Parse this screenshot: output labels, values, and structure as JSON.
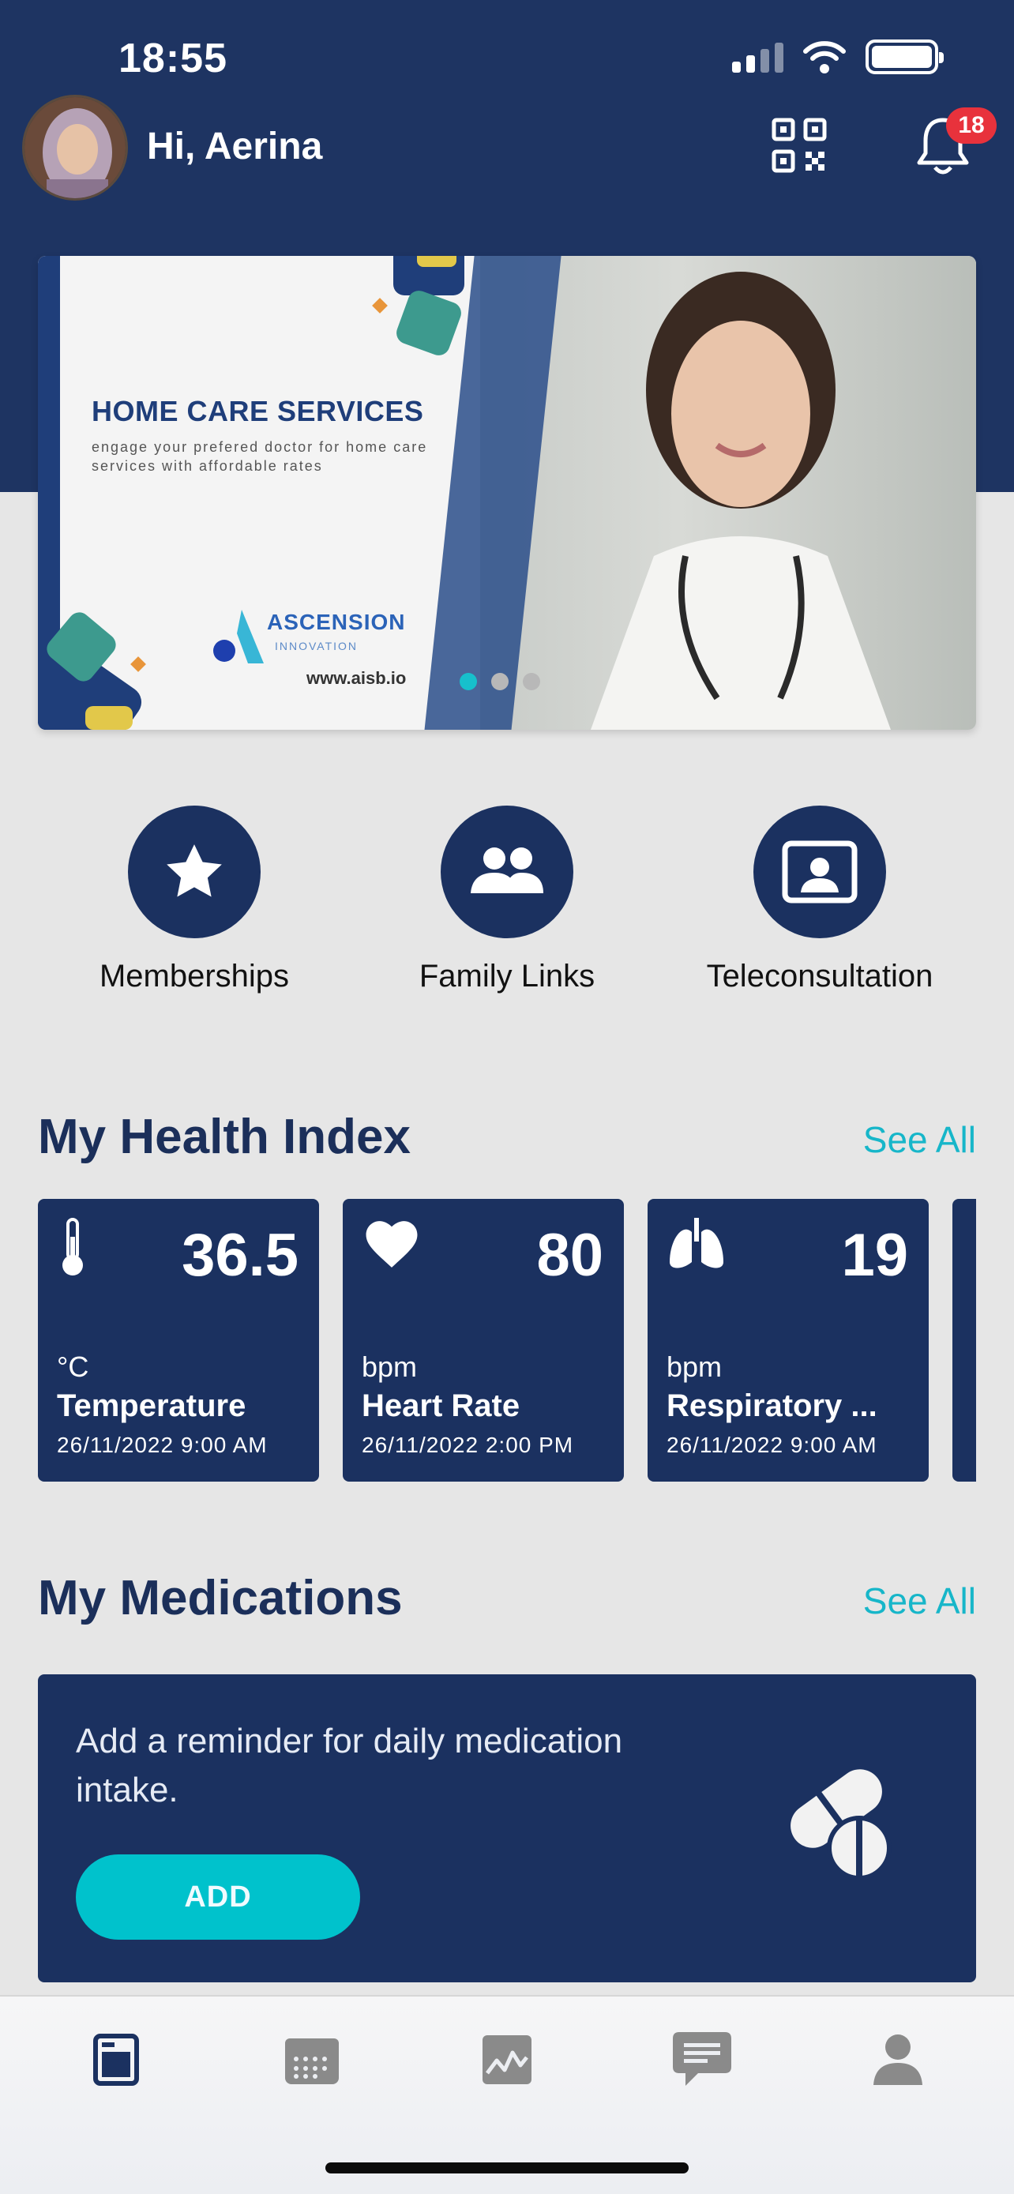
{
  "status_bar": {
    "time": "18:55"
  },
  "header": {
    "greeting": "Hi, Aerina",
    "notification_count": "18",
    "icons": [
      "qr-code-icon",
      "bell-icon"
    ]
  },
  "banner": {
    "title": "HOME CARE SERVICES",
    "subtitle": "engage your prefered doctor for home care services with affordable rates",
    "brand": "ASCENSION",
    "brand_sub": "INNOVATION",
    "url": "www.aisb.io",
    "slide_count": 3,
    "active_slide": 1
  },
  "shortcuts": [
    {
      "label": "Memberships",
      "icon": "star-icon"
    },
    {
      "label": "Family Links",
      "icon": "people-icon"
    },
    {
      "label": "Teleconsultation",
      "icon": "video-call-icon"
    }
  ],
  "health_index": {
    "title": "My Health Index",
    "see_all": "See All",
    "cards": [
      {
        "value": "36.5",
        "unit": "°C",
        "name": "Temperature",
        "time": "26/11/2022 9:00 AM",
        "icon": "thermometer-icon"
      },
      {
        "value": "80",
        "unit": "bpm",
        "name": "Heart Rate",
        "time": "26/11/2022 2:00 PM",
        "icon": "heart-icon"
      },
      {
        "value": "19",
        "unit": "bpm",
        "name": "Respiratory ...",
        "time": "26/11/2022 9:00 AM",
        "icon": "lungs-icon"
      }
    ]
  },
  "medications": {
    "title": "My Medications",
    "see_all": "See All",
    "reminder_text": "Add a reminder for daily medication intake.",
    "add_label": "ADD",
    "icon": "pills-icon"
  },
  "bottom_nav": [
    {
      "icon": "home-icon",
      "active": true
    },
    {
      "icon": "calendar-icon",
      "active": false
    },
    {
      "icon": "activity-chart-icon",
      "active": false
    },
    {
      "icon": "chat-icon",
      "active": false
    },
    {
      "icon": "profile-icon",
      "active": false
    }
  ],
  "colors": {
    "navy": "#1b3160",
    "accent": "#17b6c9",
    "button": "#00c2cc",
    "badge": "#e8323c"
  }
}
